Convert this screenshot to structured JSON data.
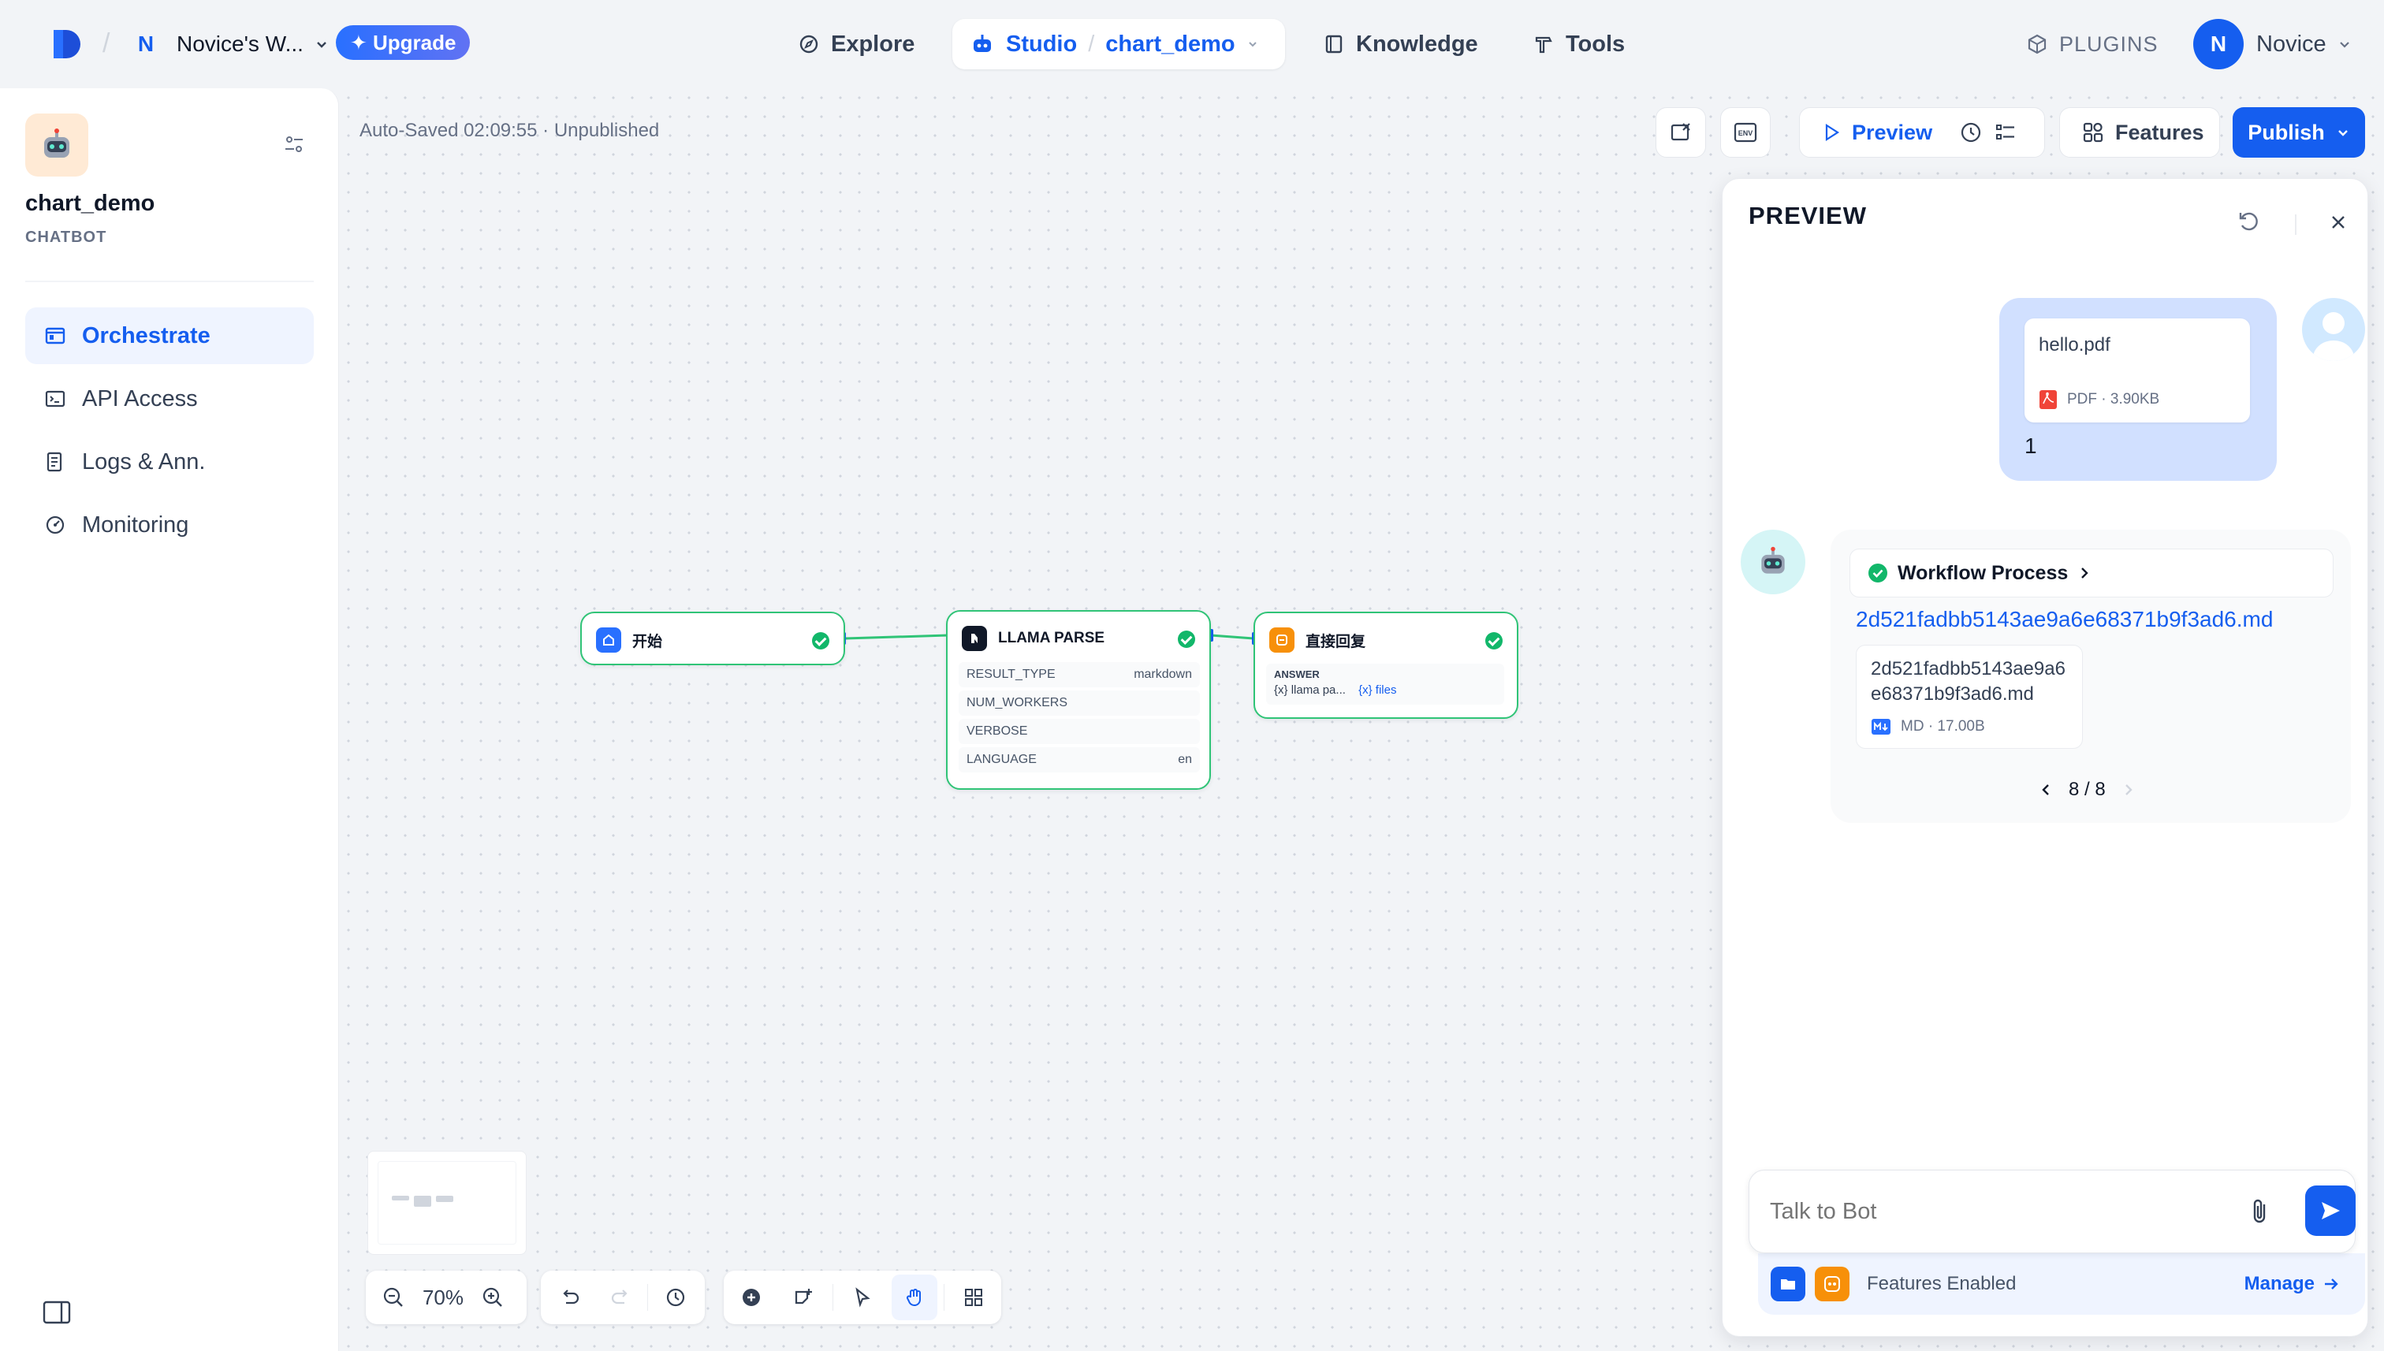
{
  "header": {
    "workspace_initial": "N",
    "workspace_name": "Novice's W...",
    "upgrade_label": "Upgrade",
    "nav": {
      "explore": "Explore",
      "studio": "Studio",
      "studio_app": "chart_demo",
      "knowledge": "Knowledge",
      "tools": "Tools"
    },
    "plugins_label": "PLUGINS",
    "user_initial": "N",
    "user_name": "Novice"
  },
  "sidebar": {
    "app_name": "chart_demo",
    "app_type": "CHATBOT",
    "items": [
      {
        "label": "Orchestrate",
        "active": true,
        "icon": "layout-icon"
      },
      {
        "label": "API Access",
        "active": false,
        "icon": "terminal-icon"
      },
      {
        "label": "Logs & Ann.",
        "active": false,
        "icon": "document-icon"
      },
      {
        "label": "Monitoring",
        "active": false,
        "icon": "gauge-icon"
      }
    ]
  },
  "canvas": {
    "autosave": "Auto-Saved 02:09:55 · Unpublished",
    "zoom": "70%",
    "nodes": {
      "start": {
        "title": "开始"
      },
      "llama": {
        "title": "LLAMA PARSE",
        "rows": [
          {
            "key": "RESULT_TYPE",
            "value": "markdown"
          },
          {
            "key": "NUM_WORKERS",
            "value": ""
          },
          {
            "key": "VERBOSE",
            "value": ""
          },
          {
            "key": "LANGUAGE",
            "value": "en"
          }
        ]
      },
      "answer": {
        "title": "直接回复",
        "label": "ANSWER",
        "var1": "llama pa...",
        "var2": "files"
      }
    }
  },
  "actions": {
    "preview": "Preview",
    "features": "Features",
    "publish": "Publish"
  },
  "preview": {
    "title": "PREVIEW",
    "user_file_name": "hello.pdf",
    "user_file_meta": "PDF · 3.90KB",
    "user_message": "1",
    "workflow_label": "Workflow Process",
    "response_link": "2d521fadbb5143ae9a6e68371b9f3ad6.md",
    "md_file_name": "2d521fadbb5143ae9a6e68371b9f3ad6.md",
    "md_file_meta": "MD · 17.00B",
    "pager": "8 / 8",
    "input_placeholder": "Talk to Bot",
    "features_enabled": "Features Enabled",
    "manage": "Manage"
  },
  "colors": {
    "accent": "#155eef",
    "node_border": "#30c477",
    "success": "#12b76a",
    "start_icon": "#2970ff",
    "answer_icon": "#f79009"
  }
}
